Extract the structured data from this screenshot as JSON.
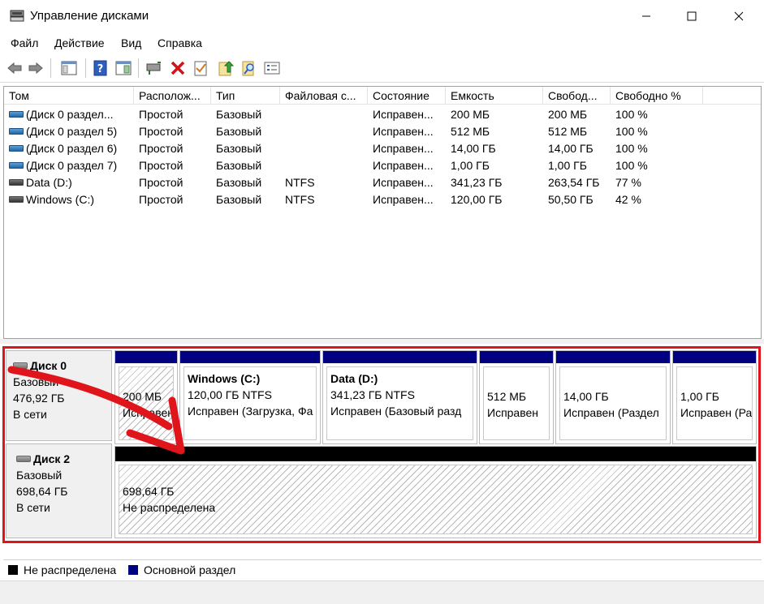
{
  "window": {
    "title": "Управление дисками"
  },
  "menu": [
    "Файл",
    "Действие",
    "Вид",
    "Справка"
  ],
  "toolbar": {
    "icons": [
      "back-icon",
      "forward-icon",
      "console-tree-icon",
      "help-icon",
      "action-pane-icon",
      "connect-icon",
      "delete-icon",
      "properties-icon",
      "export-icon",
      "find-icon",
      "settings-list-icon"
    ]
  },
  "table": {
    "columns": [
      "Том",
      "Располож...",
      "Тип",
      "Файловая с...",
      "Состояние",
      "Емкость",
      "Свобод...",
      "Свободно %"
    ],
    "rows": [
      [
        "(Диск 0 раздел...",
        "Простой",
        "Базовый",
        "",
        "Исправен...",
        "200 МБ",
        "200 МБ",
        "100 %"
      ],
      [
        "(Диск 0 раздел 5)",
        "Простой",
        "Базовый",
        "",
        "Исправен...",
        "512 МБ",
        "512 МБ",
        "100 %"
      ],
      [
        "(Диск 0 раздел 6)",
        "Простой",
        "Базовый",
        "",
        "Исправен...",
        "14,00 ГБ",
        "14,00 ГБ",
        "100 %"
      ],
      [
        "(Диск 0 раздел 7)",
        "Простой",
        "Базовый",
        "",
        "Исправен...",
        "1,00 ГБ",
        "1,00 ГБ",
        "100 %"
      ],
      [
        "Data (D:)",
        "Простой",
        "Базовый",
        "NTFS",
        "Исправен...",
        "341,23 ГБ",
        "263,54 ГБ",
        "77 %"
      ],
      [
        "Windows (C:)",
        "Простой",
        "Базовый",
        "NTFS",
        "Исправен...",
        "120,00 ГБ",
        "50,50 ГБ",
        "42 %"
      ]
    ]
  },
  "disks": [
    {
      "name": "Диск 0",
      "type": "Базовый",
      "size": "476,92 ГБ",
      "status": "В сети",
      "partitions": [
        {
          "size": "200 МБ",
          "status": "Исправен"
        },
        {
          "name": "Windows  (C:)",
          "size": "120,00 ГБ NTFS",
          "status": "Исправен (Загрузка, Фа"
        },
        {
          "name": "Data  (D:)",
          "size": "341,23 ГБ NTFS",
          "status": "Исправен (Базовый разд"
        },
        {
          "size": "512 МБ",
          "status": "Исправен"
        },
        {
          "size": "14,00 ГБ",
          "status": "Исправен (Раздел"
        },
        {
          "size": "1,00 ГБ",
          "status": "Исправен (Ра"
        }
      ]
    },
    {
      "name": "Диск 2",
      "type": "Базовый",
      "size": "698,64 ГБ",
      "status": "В сети",
      "partitions": [
        {
          "size": "698,64 ГБ",
          "status": "Не распределена"
        }
      ]
    }
  ],
  "legend": [
    {
      "label": "Не распределена",
      "color": "#000000"
    },
    {
      "label": "Основной раздел",
      "color": "#000080"
    }
  ],
  "colors": {
    "primary_partition": "#000080",
    "unallocated": "#000000",
    "highlight_frame": "#e0151b",
    "annotation_arrow": "#e0151b"
  }
}
